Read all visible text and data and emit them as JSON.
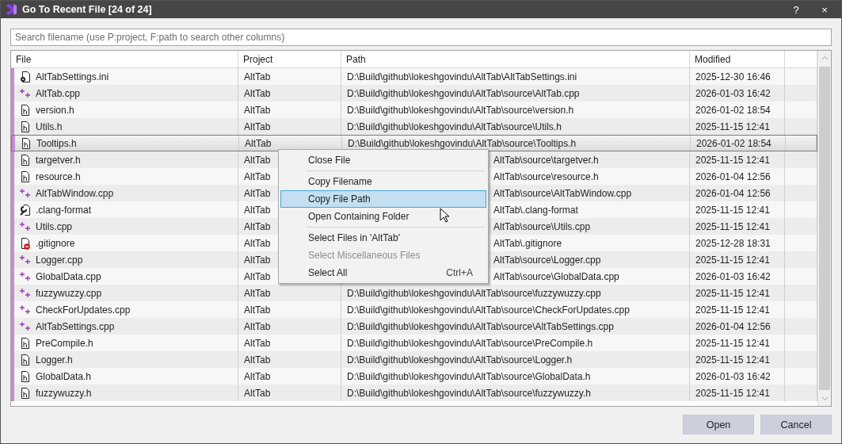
{
  "window": {
    "title": "Go To Recent File [24 of 24]",
    "help": "?",
    "close": "×"
  },
  "search": {
    "placeholder": "Search filename (use P:project, F:path to search other columns)"
  },
  "table": {
    "columns": [
      "File",
      "Project",
      "Path",
      "Modified"
    ],
    "rows": [
      {
        "file": "AltTabSettings.ini",
        "kind": "ini",
        "project": "AltTab",
        "path": "D:\\Build\\github\\lokeshgovindu\\AltTab\\AltTabSettings.ini",
        "modified": "2025-12-30 16:46",
        "selected": false,
        "covered": false
      },
      {
        "file": "AltTab.cpp",
        "kind": "cpp",
        "project": "AltTab",
        "path": "D:\\Build\\github\\lokeshgovindu\\AltTab\\source\\AltTab.cpp",
        "modified": "2026-01-03 16:42",
        "selected": false,
        "covered": false
      },
      {
        "file": "version.h",
        "kind": "h",
        "project": "AltTab",
        "path": "D:\\Build\\github\\lokeshgovindu\\AltTab\\source\\version.h",
        "modified": "2026-01-02 18:54",
        "selected": false,
        "covered": false
      },
      {
        "file": "Utils.h",
        "kind": "h",
        "project": "AltTab",
        "path": "D:\\Build\\github\\lokeshgovindu\\AltTab\\source\\Utils.h",
        "modified": "2025-11-15 12:41",
        "selected": false,
        "covered": false
      },
      {
        "file": "Tooltips.h",
        "kind": "h",
        "project": "AltTab",
        "path": "D:\\Build\\github\\lokeshgovindu\\AltTab\\source\\Tooltips.h",
        "modified": "2026-01-02 18:54",
        "selected": true,
        "covered": false
      },
      {
        "file": "targetver.h",
        "kind": "h",
        "project": "AltTab",
        "path": "AltTab\\source\\targetver.h",
        "modified": "2025-11-15 12:41",
        "selected": false,
        "covered": true
      },
      {
        "file": "resource.h",
        "kind": "h",
        "project": "AltTab",
        "path": "AltTab\\source\\resource.h",
        "modified": "2026-01-04 12:56",
        "selected": false,
        "covered": true
      },
      {
        "file": "AltTabWindow.cpp",
        "kind": "cpp",
        "project": "AltTab",
        "path": "AltTab\\source\\AltTabWindow.cpp",
        "modified": "2026-01-04 12:56",
        "selected": false,
        "covered": true
      },
      {
        "file": ".clang-format",
        "kind": "config",
        "project": "AltTab",
        "path": "AltTab\\.clang-format",
        "modified": "2025-11-15 12:41",
        "selected": false,
        "covered": true
      },
      {
        "file": "Utils.cpp",
        "kind": "cpp",
        "project": "AltTab",
        "path": "AltTab\\source\\Utils.cpp",
        "modified": "2025-11-15 12:41",
        "selected": false,
        "covered": true
      },
      {
        "file": ".gitignore",
        "kind": "ignored",
        "project": "AltTab",
        "path": "AltTab\\.gitignore",
        "modified": "2025-12-28 18:31",
        "selected": false,
        "covered": true
      },
      {
        "file": "Logger.cpp",
        "kind": "cpp",
        "project": "AltTab",
        "path": "AltTab\\source\\Logger.cpp",
        "modified": "2025-11-15 12:41",
        "selected": false,
        "covered": true
      },
      {
        "file": "GlobalData.cpp",
        "kind": "cpp",
        "project": "AltTab",
        "path": "AltTab\\source\\GlobalData.cpp",
        "modified": "2026-01-03 16:42",
        "selected": false,
        "covered": true
      },
      {
        "file": "fuzzywuzzy.cpp",
        "kind": "cpp",
        "project": "AltTab",
        "path": "D:\\Build\\github\\lokeshgovindu\\AltTab\\source\\fuzzywuzzy.cpp",
        "modified": "2025-11-15 12:41",
        "selected": false,
        "covered": false
      },
      {
        "file": "CheckForUpdates.cpp",
        "kind": "cpp",
        "project": "AltTab",
        "path": "D:\\Build\\github\\lokeshgovindu\\AltTab\\source\\CheckForUpdates.cpp",
        "modified": "2025-11-15 12:41",
        "selected": false,
        "covered": false
      },
      {
        "file": "AltTabSettings.cpp",
        "kind": "cpp",
        "project": "AltTab",
        "path": "D:\\Build\\github\\lokeshgovindu\\AltTab\\source\\AltTabSettings.cpp",
        "modified": "2026-01-04 12:56",
        "selected": false,
        "covered": false
      },
      {
        "file": "PreCompile.h",
        "kind": "h",
        "project": "AltTab",
        "path": "D:\\Build\\github\\lokeshgovindu\\AltTab\\source\\PreCompile.h",
        "modified": "2025-11-15 12:41",
        "selected": false,
        "covered": false
      },
      {
        "file": "Logger.h",
        "kind": "h",
        "project": "AltTab",
        "path": "D:\\Build\\github\\lokeshgovindu\\AltTab\\source\\Logger.h",
        "modified": "2025-11-15 12:41",
        "selected": false,
        "covered": false
      },
      {
        "file": "GlobalData.h",
        "kind": "h",
        "project": "AltTab",
        "path": "D:\\Build\\github\\lokeshgovindu\\AltTab\\source\\GlobalData.h",
        "modified": "2026-01-03 16:42",
        "selected": false,
        "covered": false
      },
      {
        "file": "fuzzywuzzy.h",
        "kind": "h",
        "project": "AltTab",
        "path": "D:\\Build\\github\\lokeshgovindu\\AltTab\\source\\fuzzywuzzy.h",
        "modified": "2025-11-15 12:41",
        "selected": false,
        "covered": false
      }
    ]
  },
  "context_menu": {
    "items": [
      {
        "kind": "item",
        "label": "Close File",
        "selected": false,
        "disabled": false
      },
      {
        "kind": "separator"
      },
      {
        "kind": "item",
        "label": "Copy Filename",
        "selected": false,
        "disabled": false
      },
      {
        "kind": "item",
        "label": "Copy File Path",
        "selected": true,
        "disabled": false
      },
      {
        "kind": "item",
        "label": "Open Containing Folder",
        "selected": false,
        "disabled": false
      },
      {
        "kind": "separator"
      },
      {
        "kind": "item",
        "label": "Select Files in 'AltTab'",
        "selected": false,
        "disabled": false
      },
      {
        "kind": "item",
        "label": "Select Miscellaneous Files",
        "selected": false,
        "disabled": true
      },
      {
        "kind": "item",
        "label": "Select All",
        "shortcut": "Ctrl+A",
        "selected": false,
        "disabled": false
      }
    ]
  },
  "buttons": [
    "Open",
    "Cancel"
  ]
}
